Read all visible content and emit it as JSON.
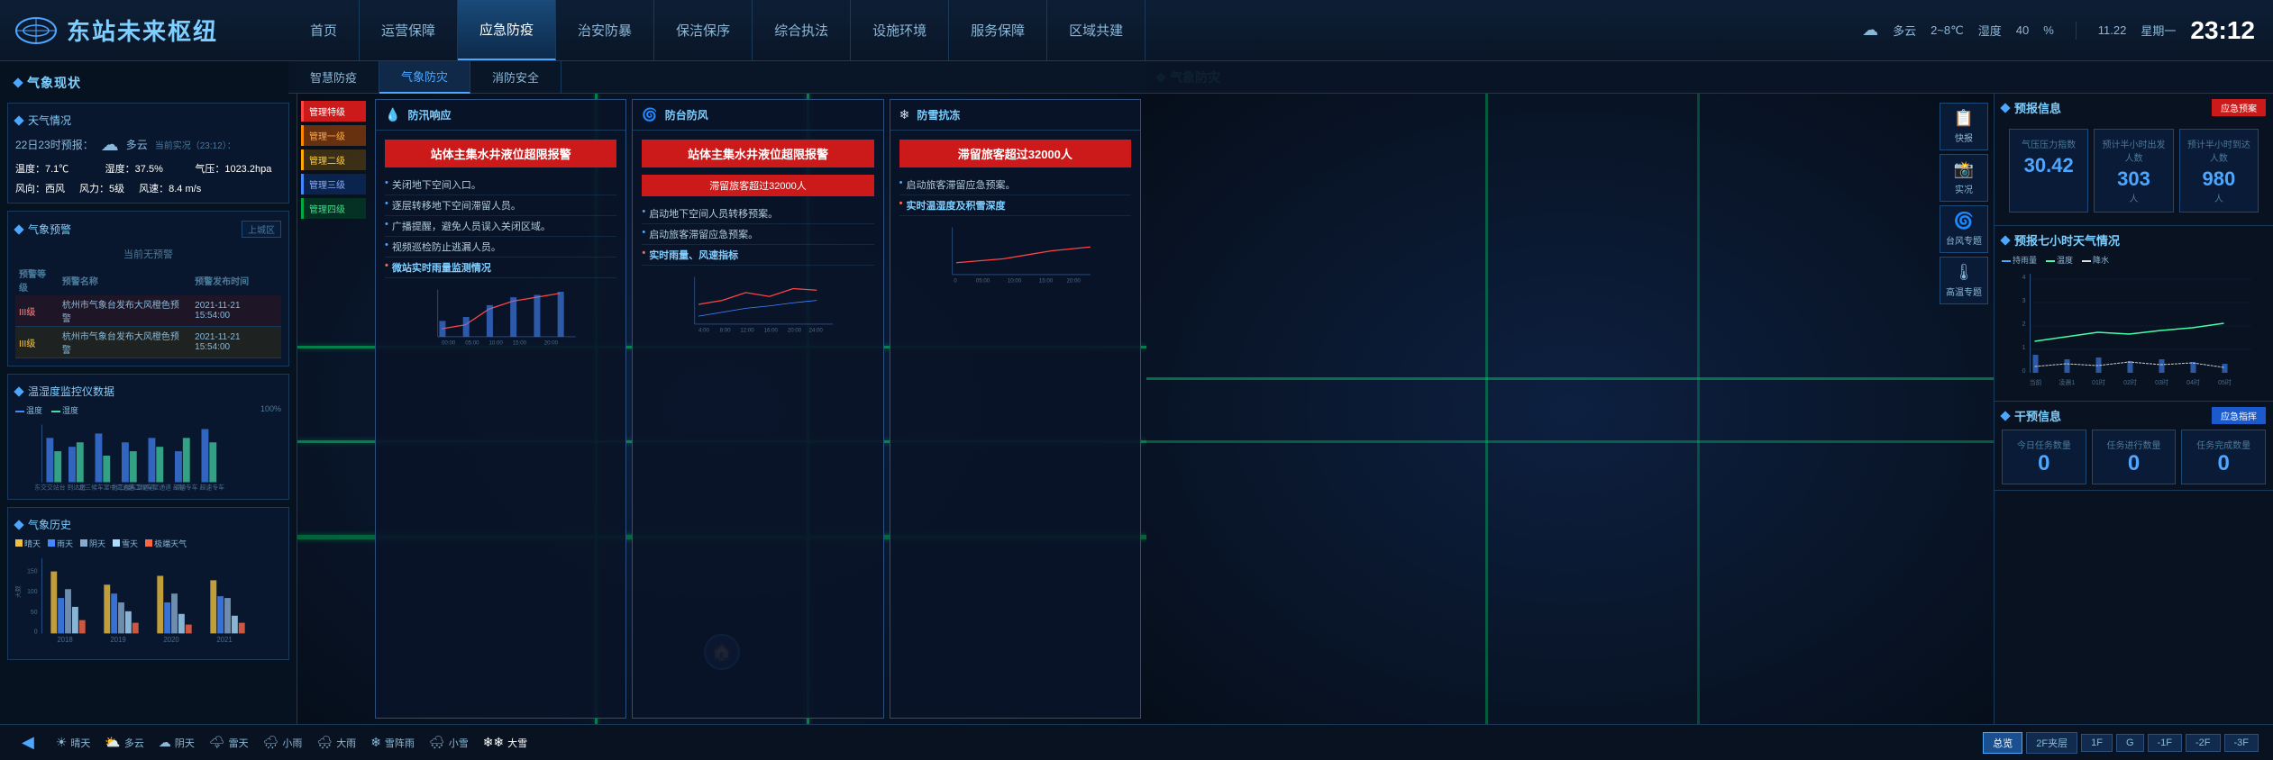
{
  "app": {
    "logo_text": "东站未来枢纽",
    "title": "东站未来枢纽"
  },
  "nav": {
    "tabs": [
      {
        "label": "首页",
        "active": false
      },
      {
        "label": "运营保障",
        "active": false
      },
      {
        "label": "应急防疫",
        "active": true
      },
      {
        "label": "治安防暴",
        "active": false
      },
      {
        "label": "保洁保序",
        "active": false
      },
      {
        "label": "综合执法",
        "active": false
      },
      {
        "label": "设施环境",
        "active": false
      },
      {
        "label": "服务保障",
        "active": false
      },
      {
        "label": "区域共建",
        "active": false
      }
    ],
    "sub_tabs": [
      {
        "label": "智慧防疫",
        "active": false
      },
      {
        "label": "气象防灾",
        "active": true
      },
      {
        "label": "消防安全",
        "active": false
      }
    ]
  },
  "weather_top": {
    "icon": "☁",
    "desc": "多云",
    "temp_range": "2~8℃",
    "humidity_label": "湿度",
    "humidity_value": "40",
    "humidity_unit": "%",
    "date": "11.22",
    "weekday": "星期一",
    "time": "23:12"
  },
  "left_panel": {
    "title": "气象现状",
    "weather_status": {
      "title": "天气情况",
      "forecast_label": "22日23时预报：",
      "forecast_icon": "☁",
      "forecast_desc": "多云",
      "realtime_label": "当前实况（23:12）：",
      "temp_label": "温度：",
      "temp_value": "7.1℃",
      "humidity_label": "湿度：",
      "humidity_value": "37.5%",
      "pressure_label": "气压：",
      "pressure_value": "1023.2hpa",
      "wind_dir_label": "风向：",
      "wind_dir_value": "西风",
      "wind_level_label": "风力：",
      "wind_level_value": "5级",
      "wind_speed_label": "风速：",
      "wind_speed_value": "8.4 m/s"
    },
    "weather_alert": {
      "title": "气象预警",
      "region_label": "上城区",
      "no_alert": "当前无预警",
      "alerts": [
        {
          "level": "III级",
          "name": "杭州市气象台发布大风橙色预警",
          "time": "2021-11-21 15:54:00",
          "highlight": true
        },
        {
          "level": "III级",
          "name": "杭州市气象台发布大风橙色预警",
          "time": "2021-11-21 15:54:00",
          "highlight": false
        }
      ]
    },
    "temp_monitor": {
      "title": "温湿度监控仪数据",
      "legend": [
        "温度",
        "湿度"
      ],
      "stations": [
        "东交交站台",
        "到达层",
        "北三候车室中间通道",
        "北二候车室通道",
        "北二候车室通道（南）",
        "超速专车",
        "超速专车"
      ]
    },
    "weather_history": {
      "title": "气象历史",
      "y_label": "天数",
      "categories": [
        "晴天",
        "雨天",
        "阴天",
        "雪天",
        "极端天气"
      ],
      "years": [
        "2018",
        "2019",
        "2020",
        "2021"
      ]
    }
  },
  "emergency": {
    "levels": [
      {
        "label": "管理特级",
        "class": "l0"
      },
      {
        "label": "管理一级",
        "class": "l1"
      },
      {
        "label": "管理二级",
        "class": "l2"
      },
      {
        "label": "管理三级",
        "class": "l3"
      },
      {
        "label": "管理四级",
        "class": "l4"
      }
    ]
  },
  "alert_cards": [
    {
      "id": "flood",
      "icon": "💧",
      "title": "防汛响应",
      "alert_text": "站体主集水井液位超限报警",
      "items": [
        "关闭地下空间入口。",
        "逐层转移地下空间滞留人员。",
        "广播提醒，避免人员误入关闭区域。",
        "视频巡检防止逃漏人员。"
      ],
      "highlight_item": "微站实时雨量监测情况",
      "chart_type": "rain",
      "chart_x": [
        "00:00",
        "05:00",
        "10:00",
        "15:00",
        "20:00"
      ]
    },
    {
      "id": "typhoon",
      "icon": "🌀",
      "title": "防台防风",
      "alert_text": "站体主集水井液位超限报警",
      "alert_sub": "滞留旅客超过32000人",
      "items": [
        "启动地下空间人员转移预案。",
        "启动旅客滞留应急预案。"
      ],
      "highlight_item": "实时雨量、风速指标",
      "chart_type": "wind",
      "chart_x": [
        "4:00",
        "8:00",
        "12:00",
        "16:00",
        "20:00",
        "24:00"
      ]
    },
    {
      "id": "snow",
      "icon": "❄",
      "title": "防雪抗冻",
      "alert_text": "滞留旅客超过32000人",
      "items": [
        "启动旅客滞留应急预案。"
      ],
      "highlight_item": "实时温湿度及积雪深度",
      "chart_type": "snow",
      "chart_x": [
        "0",
        "05:00",
        "10:00",
        "15:00",
        "20:00"
      ]
    }
  ],
  "right_panel": {
    "title": "气象防灾",
    "forecast_section": {
      "title": "预报信息",
      "btn_label": "应急预案",
      "pressure_label": "气压压力指数",
      "pressure_value": "30.42",
      "half_hour_out_label": "预计半小时出发人数",
      "half_hour_out_value": "303",
      "half_hour_out_unit": "人",
      "half_hour_arrive_label": "预计半小时到达人数",
      "half_hour_arrive_value": "980",
      "half_hour_arrive_unit": "人"
    },
    "seven_hour_forecast": {
      "title": "预报七小时天气情况",
      "legend": [
        "持雨量",
        "温度",
        "降水"
      ],
      "y_axis": [
        "0",
        "1",
        "2",
        "3",
        "4"
      ],
      "x_axis": [
        "当前",
        "凌晨1",
        "01时",
        "02时",
        "03时",
        "04时",
        "05时"
      ]
    },
    "action_buttons": [
      {
        "label": "快报",
        "icon": "📋"
      },
      {
        "label": "实况",
        "icon": "📸"
      },
      {
        "label": "台风专题",
        "icon": "🌀"
      },
      {
        "label": "高温专题",
        "icon": "🌡"
      }
    ],
    "intervention": {
      "title": "干预信息",
      "btn_label": "应急指挥",
      "today_task_label": "今日任务数量",
      "today_task_value": "0",
      "running_task_label": "任务进行数量",
      "running_task_value": "0",
      "complete_task_label": "任务完成数量",
      "complete_task_value": "0"
    }
  },
  "bottom_bar": {
    "weather_items": [
      {
        "icon": "☀",
        "label": "晴天"
      },
      {
        "icon": "⛅",
        "label": "多云"
      },
      {
        "icon": "☁",
        "label": "阴天"
      },
      {
        "icon": "🌩",
        "label": "雷天"
      },
      {
        "icon": "🌧",
        "label": "小雨"
      },
      {
        "icon": "🌨",
        "label": "大雨"
      },
      {
        "icon": "❄",
        "label": "雪阵雨"
      },
      {
        "icon": "🌨",
        "label": "小雪"
      },
      {
        "icon": "❄❄",
        "label": "大雪",
        "active": true
      }
    ],
    "floors": [
      {
        "label": "总览",
        "active": true
      },
      {
        "label": "2F夹层"
      },
      {
        "label": "1F"
      },
      {
        "label": "G"
      },
      {
        "label": "-1F"
      },
      {
        "label": "-2F"
      },
      {
        "label": "-3F"
      }
    ]
  }
}
